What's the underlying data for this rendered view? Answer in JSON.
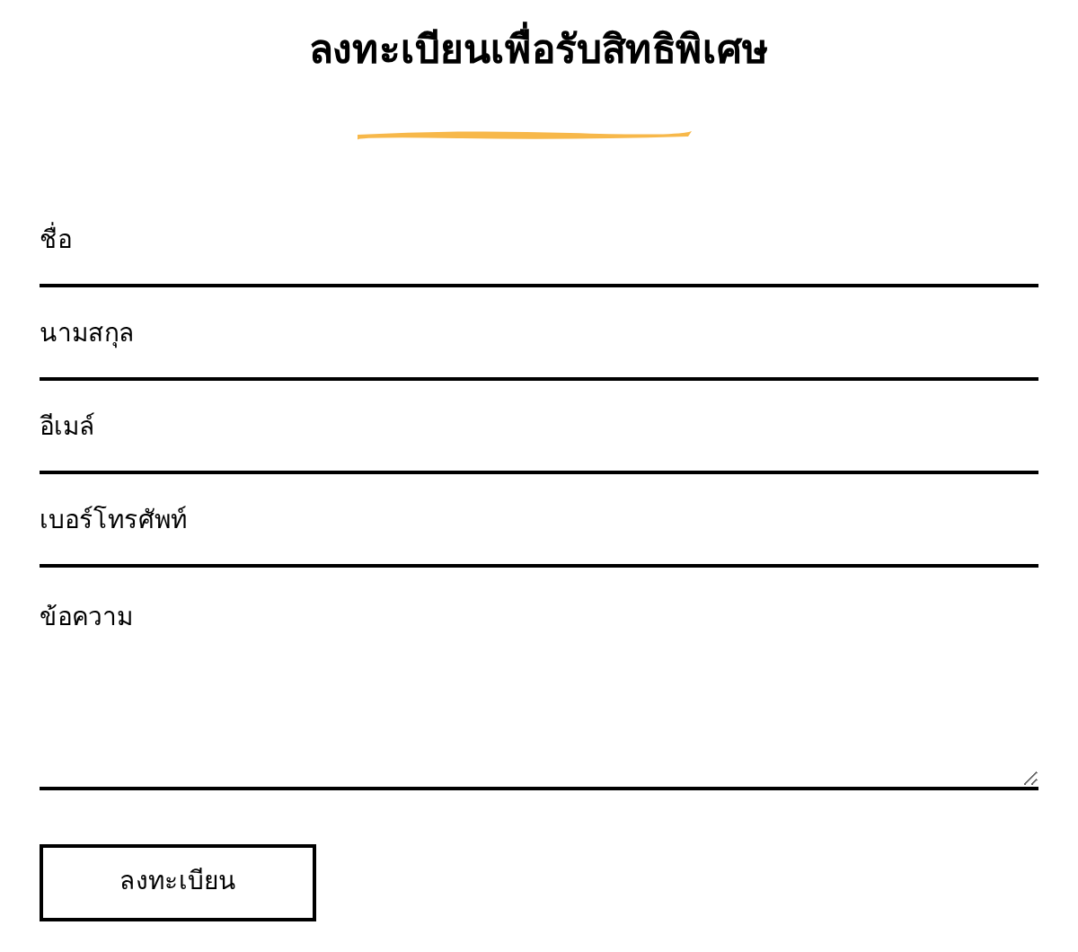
{
  "title": "ลงทะเบียนเพื่อรับสิทธิพิเศษ",
  "fields": [
    {
      "kind": "input",
      "placeholder": "ชื่อ"
    },
    {
      "kind": "input",
      "placeholder": "นามสกุล"
    },
    {
      "kind": "input",
      "placeholder": "อีเมล์"
    },
    {
      "kind": "input",
      "placeholder": "เบอร์โทรศัพท์"
    },
    {
      "kind": "textarea",
      "placeholder": "ข้อความ"
    }
  ],
  "submit": "ลงทะเบียน"
}
